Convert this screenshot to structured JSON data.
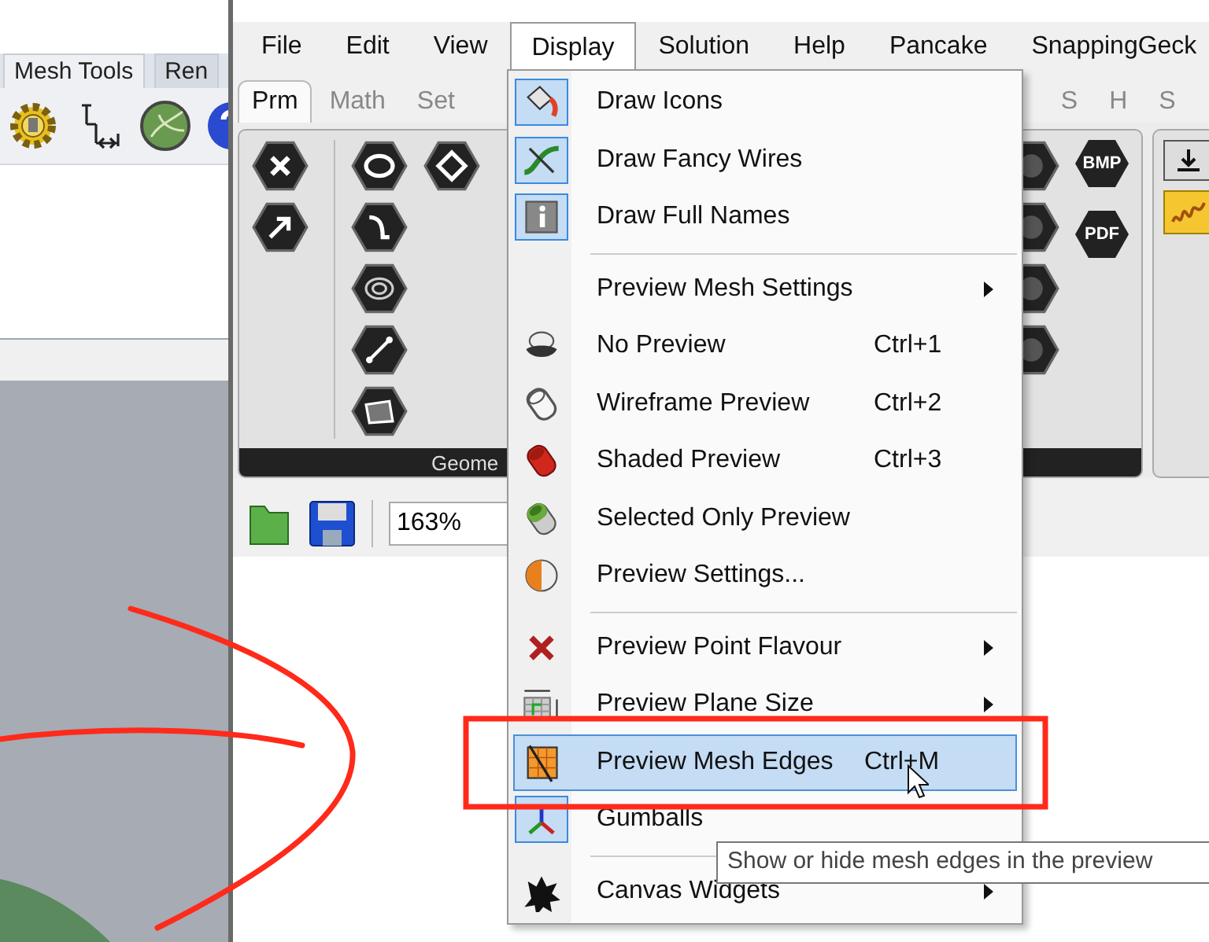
{
  "background_app": {
    "tabs": [
      {
        "label": "Mesh Tools",
        "selected": true
      },
      {
        "label": "Ren",
        "selected": false
      }
    ]
  },
  "window": {
    "menu_bar": [
      {
        "label": "File",
        "selected": false
      },
      {
        "label": "Edit",
        "selected": false
      },
      {
        "label": "View",
        "selected": false
      },
      {
        "label": "Display",
        "selected": true
      },
      {
        "label": "Solution",
        "selected": false
      },
      {
        "label": "Help",
        "selected": false
      },
      {
        "label": "Pancake",
        "selected": false
      },
      {
        "label": "SnappingGeck",
        "selected": false
      }
    ],
    "tabs": [
      {
        "label": "Prm",
        "selected": true
      },
      {
        "label": "Math",
        "selected": false
      },
      {
        "label": "Set",
        "selected": false
      },
      {
        "label": "S",
        "selected": false
      },
      {
        "label": "H",
        "selected": false
      },
      {
        "label": "S",
        "selected": false
      }
    ],
    "panel_label": "Geome",
    "file_badges": [
      "BMP",
      "PDF"
    ],
    "zoom_field": {
      "value": "163%"
    }
  },
  "display_menu": {
    "items": [
      {
        "kind": "item",
        "label": "Draw Icons",
        "checked": true,
        "selected": false
      },
      {
        "kind": "item",
        "label": "Draw Fancy Wires",
        "checked": true,
        "selected": false
      },
      {
        "kind": "item",
        "label": "Draw Full Names",
        "checked": true,
        "selected": false
      },
      {
        "kind": "separator"
      },
      {
        "kind": "item",
        "label": "Preview Mesh Settings",
        "submenu": true,
        "checked": false,
        "selected": false
      },
      {
        "kind": "item",
        "label": "No Preview",
        "shortcut": "Ctrl+1",
        "checked": false,
        "selected": false
      },
      {
        "kind": "item",
        "label": "Wireframe Preview",
        "shortcut": "Ctrl+2",
        "checked": false,
        "selected": false
      },
      {
        "kind": "item",
        "label": "Shaded Preview",
        "shortcut": "Ctrl+3",
        "checked": false,
        "selected": false
      },
      {
        "kind": "item",
        "label": "Selected Only Preview",
        "checked": false,
        "selected": false
      },
      {
        "kind": "item",
        "label": "Preview Settings...",
        "checked": false,
        "selected": false
      },
      {
        "kind": "separator"
      },
      {
        "kind": "item",
        "label": "Preview Point Flavour",
        "submenu": true,
        "checked": false,
        "selected": false
      },
      {
        "kind": "item",
        "label": "Preview Plane Size",
        "submenu": true,
        "checked": false,
        "selected": false
      },
      {
        "kind": "item",
        "label": "Preview Mesh Edges",
        "shortcut": "Ctrl+M",
        "checked": false,
        "selected": true
      },
      {
        "kind": "item",
        "label": "Gumballs",
        "checked": true,
        "selected": false
      },
      {
        "kind": "separator"
      },
      {
        "kind": "item",
        "label": "Canvas Widgets",
        "submenu": true,
        "checked": false,
        "selected": false
      }
    ]
  },
  "tooltip": "Show or hide mesh edges in the preview"
}
